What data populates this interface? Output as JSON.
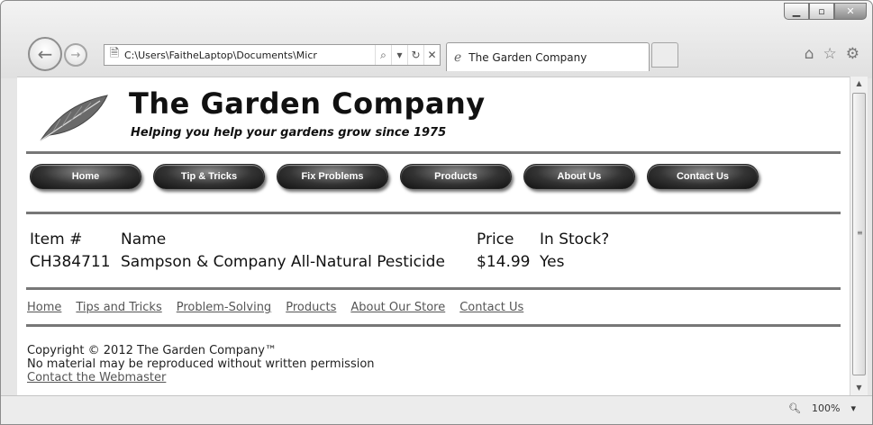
{
  "browser": {
    "url": "C:\\Users\\FaitheLaptop\\Documents\\Micr",
    "tab_title": "The Garden Company",
    "zoom": "100%"
  },
  "page": {
    "company_name": "The Garden Company",
    "tagline": "Helping you help your gardens grow since 1975",
    "nav": [
      "Home",
      "Tip & Tricks",
      "Fix Problems",
      "Products",
      "About Us",
      "Contact Us"
    ],
    "table": {
      "headers": [
        "Item #",
        "Name",
        "Price",
        "In Stock?"
      ],
      "rows": [
        [
          "CH384711",
          "Sampson & Company All-Natural Pesticide",
          "$14.99",
          "Yes"
        ]
      ]
    },
    "links": [
      "Home",
      "Tips and Tricks",
      "Problem-Solving",
      "Products",
      "About Our Store",
      "Contact Us"
    ],
    "footer": {
      "copyright": "Copyright © 2012 The Garden Company™",
      "notice": "No material may be reproduced without written permission",
      "contact_link": "Contact the Webmaster"
    }
  }
}
